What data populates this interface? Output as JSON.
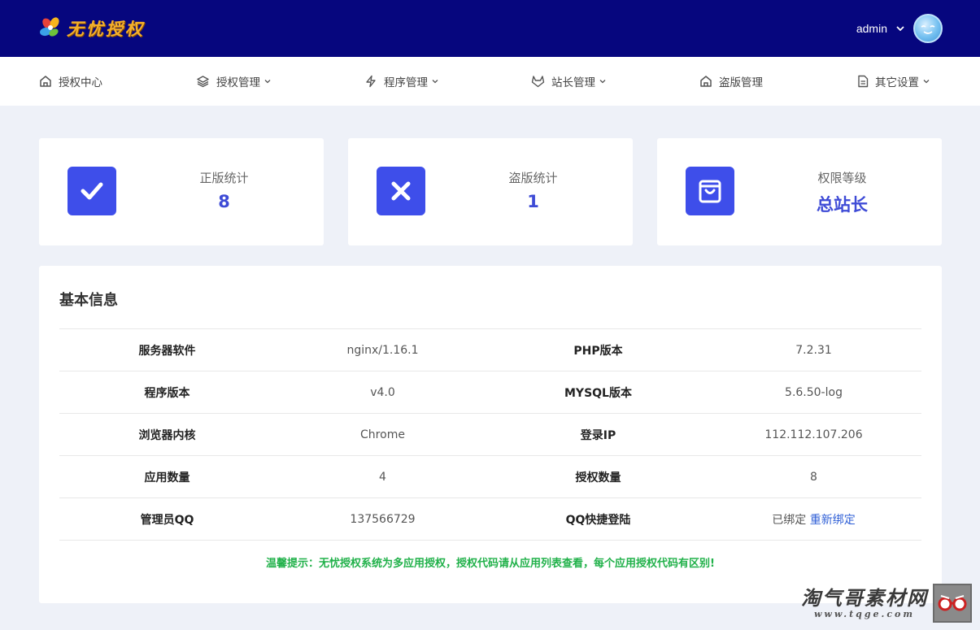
{
  "header": {
    "logo_text": "无忧授权",
    "user_name": "admin"
  },
  "nav": [
    {
      "label": "授权中心",
      "icon": "home-icon",
      "has_dropdown": false
    },
    {
      "label": "授权管理",
      "icon": "layers-icon",
      "has_dropdown": true
    },
    {
      "label": "程序管理",
      "icon": "lightning-icon",
      "has_dropdown": true
    },
    {
      "label": "站长管理",
      "icon": "gitlab-icon",
      "has_dropdown": true
    },
    {
      "label": "盗版管理",
      "icon": "home-icon",
      "has_dropdown": false
    },
    {
      "label": "其它设置",
      "icon": "document-icon",
      "has_dropdown": true
    }
  ],
  "stats": [
    {
      "label": "正版统计",
      "value": "8",
      "icon": "check-icon"
    },
    {
      "label": "盗版统计",
      "value": "1",
      "icon": "x-icon"
    },
    {
      "label": "权限等级",
      "value": "总站长",
      "icon": "shopping-bag-icon"
    }
  ],
  "info": {
    "title": "基本信息",
    "rows": [
      {
        "k1": "服务器软件",
        "v1": "nginx/1.16.1",
        "k2": "PHP版本",
        "v2": "7.2.31"
      },
      {
        "k1": "程序版本",
        "v1": "v4.0",
        "k2": "MYSQL版本",
        "v2": "5.6.50-log"
      },
      {
        "k1": "浏览器内核",
        "v1": "Chrome",
        "k2": "登录IP",
        "v2": "112.112.107.206"
      },
      {
        "k1": "应用数量",
        "v1": "4",
        "k2": "授权数量",
        "v2": "8"
      },
      {
        "k1": "管理员QQ",
        "v1": "137566729",
        "k2": "QQ快捷登陆",
        "v2": "已绑定",
        "v2_link": "重新绑定"
      }
    ],
    "tip": "温馨提示：无忧授权系统为多应用授权，授权代码请从应用列表查看，每个应用授权代码有区别!"
  },
  "watermark": {
    "title": "淘气哥素材网",
    "url": "www.tqge.com"
  },
  "colors": {
    "header_bg": "#06067e",
    "accent": "#3e4eea",
    "value_text": "#3e4bd6",
    "tip_green": "#21b14a",
    "link_blue": "#2f5fd6"
  }
}
